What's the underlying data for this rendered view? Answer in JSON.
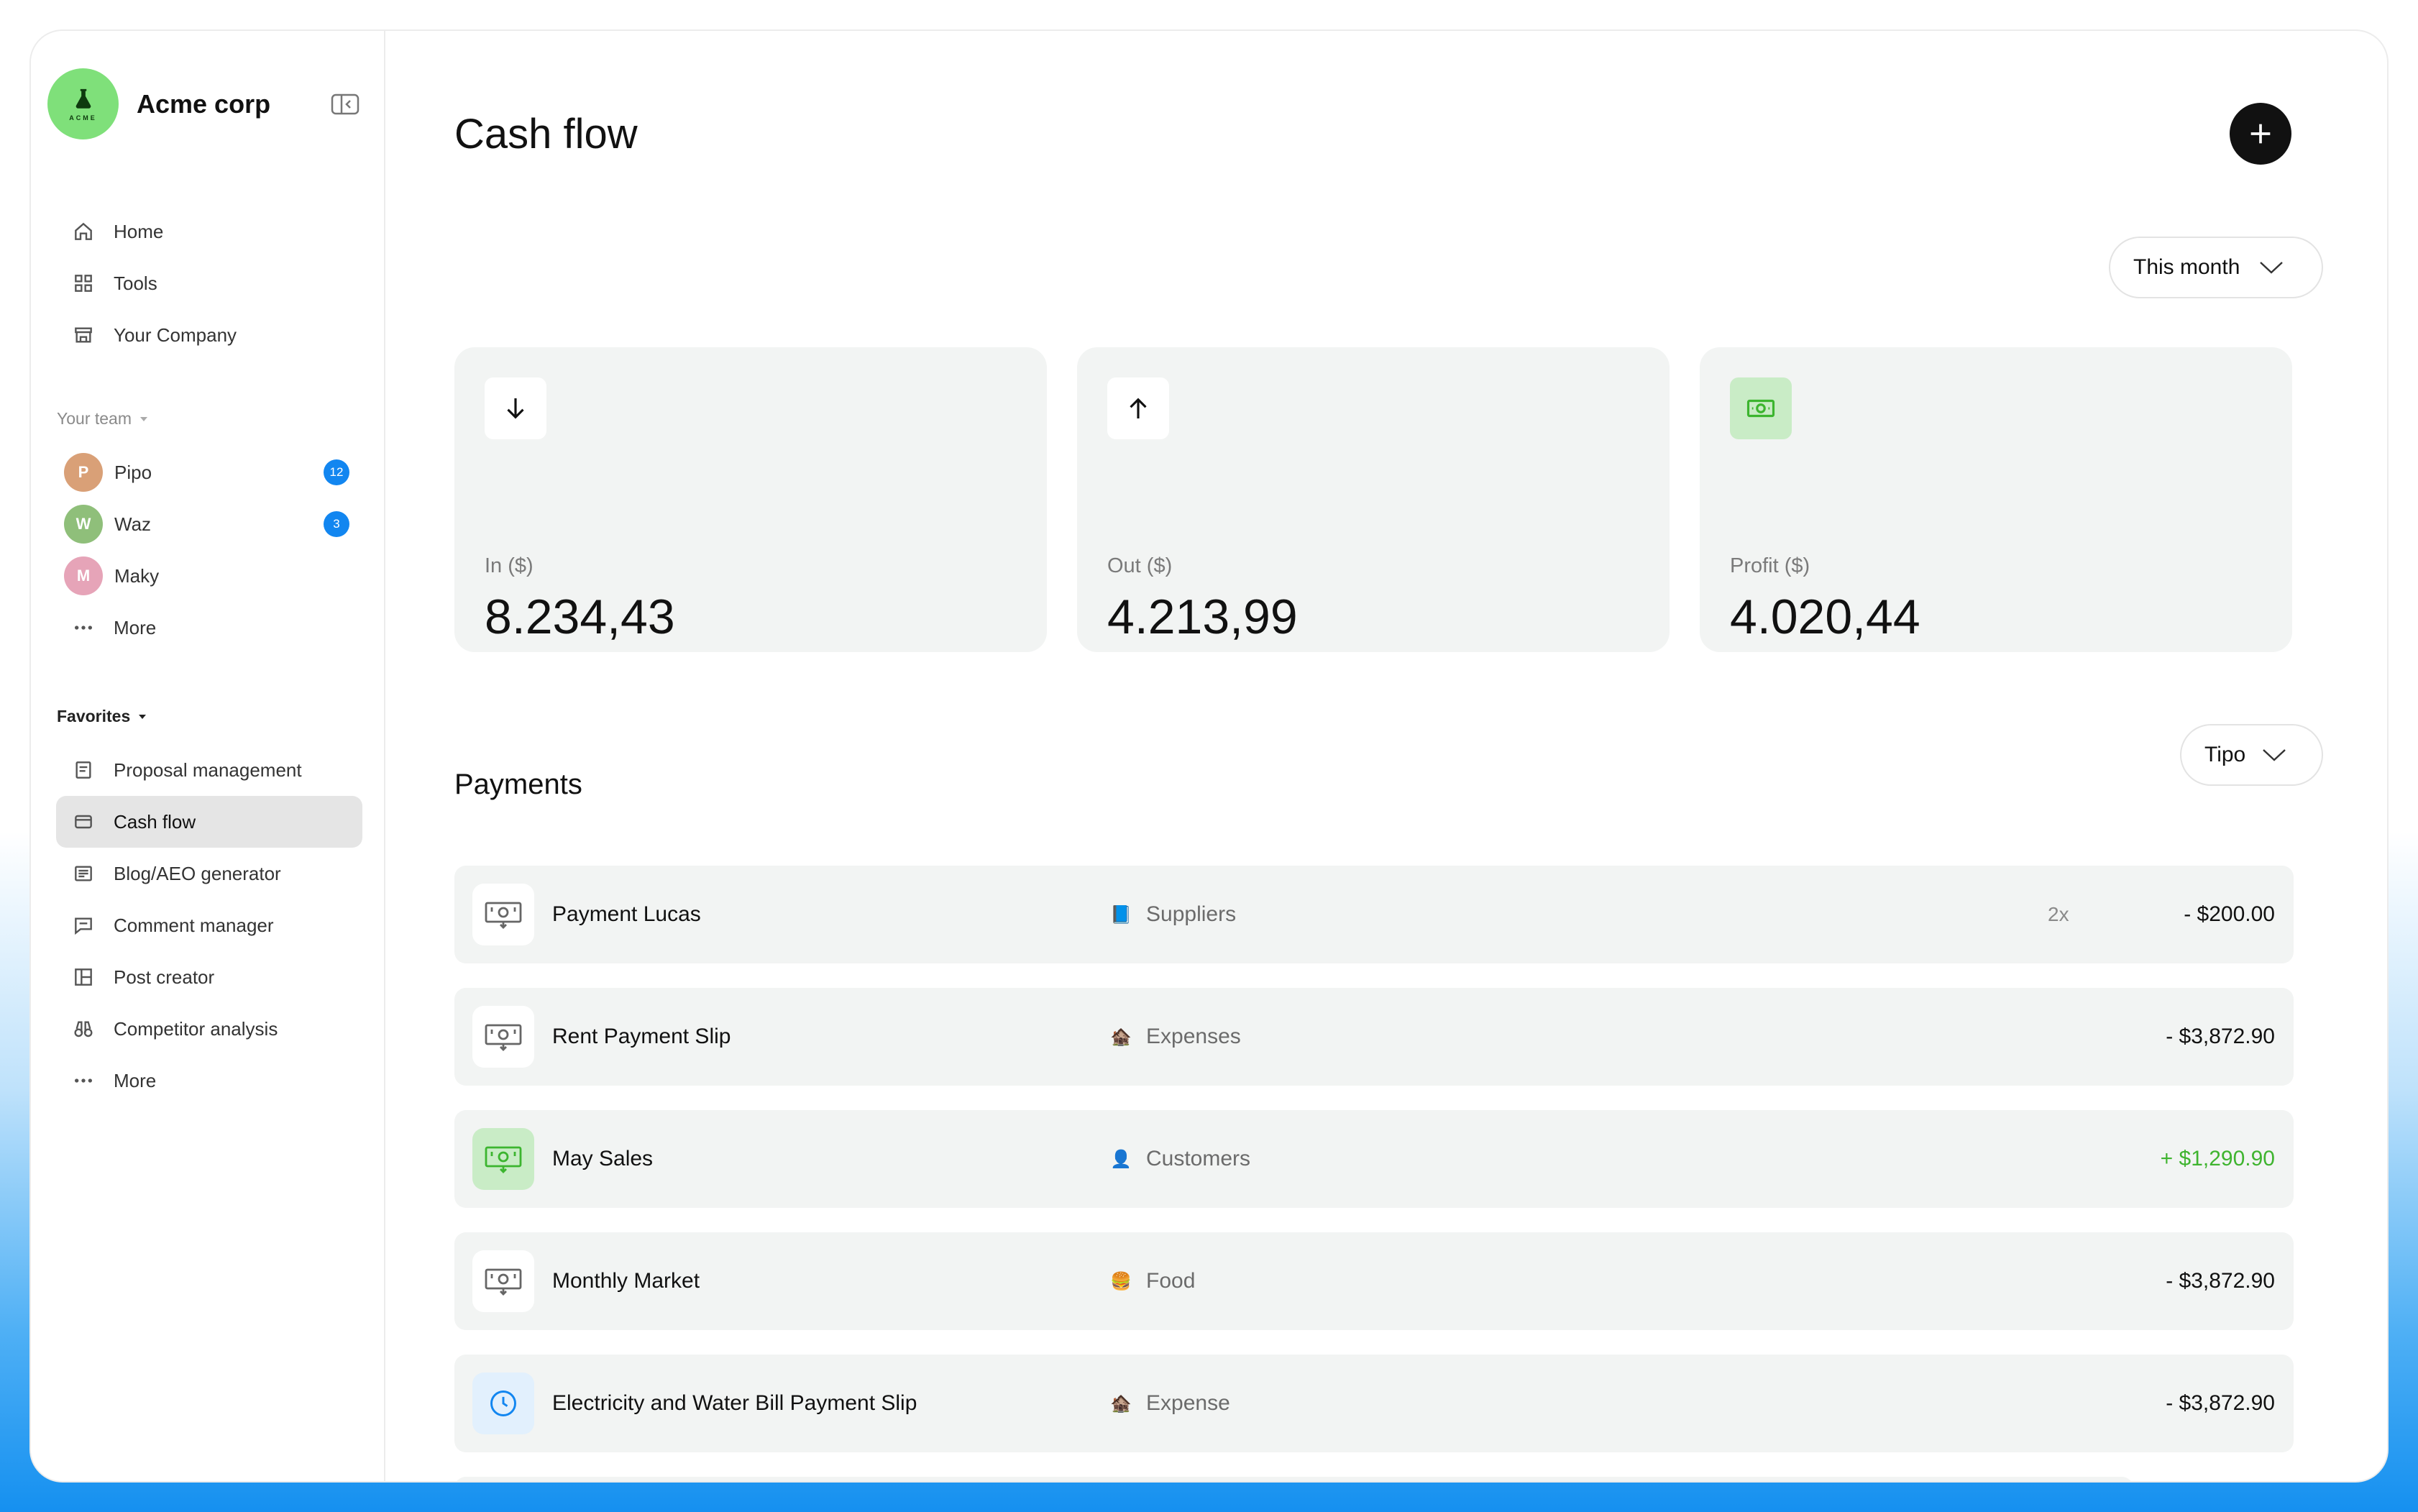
{
  "brand": {
    "name": "Acme corp",
    "mark": "ACME"
  },
  "nav": [
    {
      "label": "Home",
      "icon": "home-icon"
    },
    {
      "label": "Tools",
      "icon": "grid-icon"
    },
    {
      "label": "Your Company",
      "icon": "store-icon"
    }
  ],
  "team": {
    "label": "Your team",
    "members": [
      {
        "name": "Pipo",
        "badge": "12",
        "initial": "P",
        "color": "#d9a077"
      },
      {
        "name": "Waz",
        "badge": "3",
        "initial": "W",
        "color": "#8fbf7a"
      },
      {
        "name": "Maky",
        "badge": "",
        "initial": "M",
        "color": "#e6a4b8"
      }
    ],
    "more": "More"
  },
  "favorites": {
    "label": "Favorites",
    "items": [
      {
        "label": "Proposal management",
        "icon": "document-icon"
      },
      {
        "label": "Cash flow",
        "icon": "wallet-icon",
        "active": true
      },
      {
        "label": "Blog/AEO generator",
        "icon": "article-icon"
      },
      {
        "label": "Comment manager",
        "icon": "comment-icon"
      },
      {
        "label": "Post creator",
        "icon": "layout-icon"
      },
      {
        "label": "Competitor analysis",
        "icon": "binoculars-icon"
      }
    ],
    "more": "More"
  },
  "page": {
    "title": "Cash flow"
  },
  "period": {
    "label": "This month"
  },
  "cards": [
    {
      "label": "In ($)",
      "value": "8.234,43",
      "icon": "arrow-down-icon"
    },
    {
      "label": "Out ($)",
      "value": "4.213,99",
      "icon": "arrow-up-icon"
    },
    {
      "label": "Profit ($)",
      "value": "4.020,44",
      "icon": "money-icon"
    }
  ],
  "payments": {
    "title": "Payments",
    "filter": "Tipo",
    "rows": [
      {
        "name": "Payment Lucas",
        "category": "Suppliers",
        "emoji": "📘",
        "count": "2x",
        "amount": "- $200.00",
        "icon": "bill-icon",
        "positive": false
      },
      {
        "name": "Rent Payment Slip",
        "category": "Expenses",
        "emoji": "🏚️",
        "count": "",
        "amount": "- $3,872.90",
        "icon": "bill-icon",
        "positive": false
      },
      {
        "name": "May Sales",
        "category": "Customers",
        "emoji": "👤",
        "count": "",
        "amount": "+ $1,290.90",
        "icon": "bill-icon",
        "positive": true
      },
      {
        "name": "Monthly Market",
        "category": "Food",
        "emoji": "🍔",
        "count": "",
        "amount": "- $3,872.90",
        "icon": "bill-icon",
        "positive": false
      },
      {
        "name": "Electricity and Water Bill Payment Slip",
        "category": "Expense",
        "emoji": "🏚️",
        "count": "",
        "amount": "- $3,872.90",
        "icon": "clock-icon",
        "positive": false
      }
    ]
  },
  "colors": {
    "accent": "#1286f0",
    "positive": "#3fb42f",
    "brand": "#7fe07a"
  }
}
